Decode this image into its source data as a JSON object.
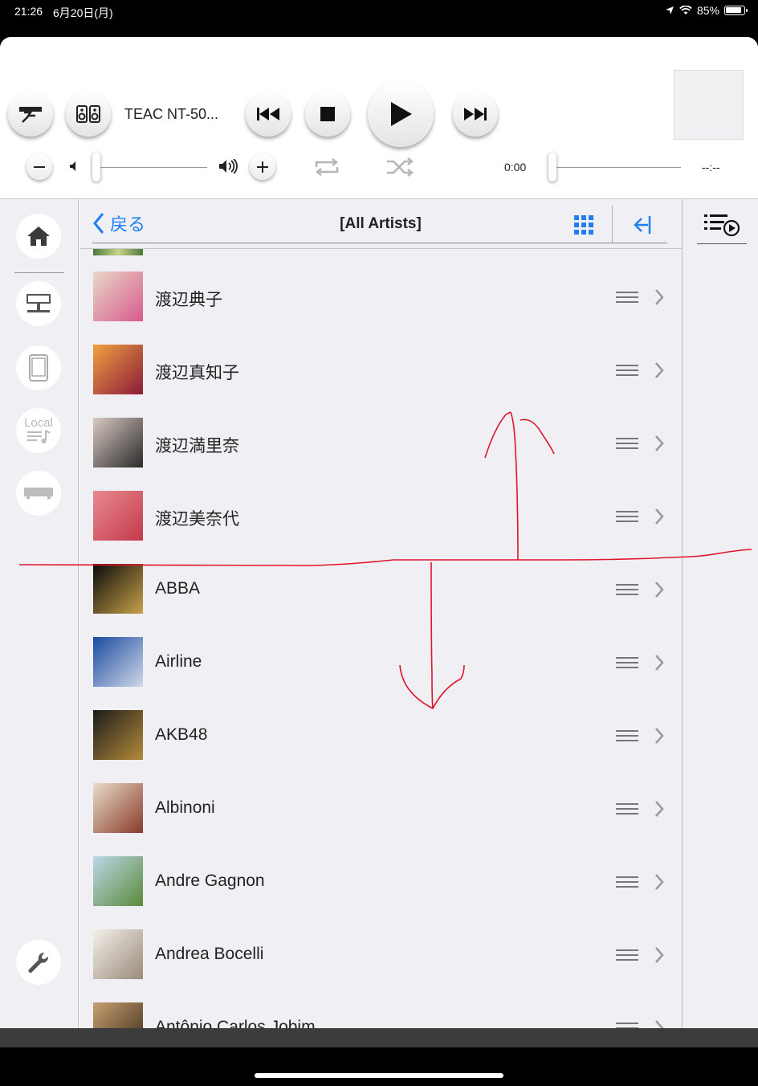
{
  "status_bar": {
    "time": "21:26",
    "date": "6月20日(月)",
    "battery": "85%"
  },
  "player": {
    "device_name": "TEAC NT-50...",
    "elapsed": "0:00",
    "remaining": "--:--"
  },
  "nav": {
    "back_label": "戻る",
    "title": "[All Artists]"
  },
  "sidebar": {
    "items": [
      {
        "icon": "home-icon"
      },
      {
        "icon": "network-device-icon"
      },
      {
        "icon": "tablet-icon"
      },
      {
        "icon": "local-music-icon",
        "label": "Local"
      },
      {
        "icon": "player-device-icon"
      },
      {
        "icon": "wrench-icon"
      }
    ]
  },
  "artists": [
    {
      "name": "渡辺典子",
      "art": [
        "#e8d7c8",
        "#d85a8c"
      ]
    },
    {
      "name": "渡辺真知子",
      "art": [
        "#f0a040",
        "#8a1a3a"
      ]
    },
    {
      "name": "渡辺満里奈",
      "art": [
        "#d9c9c3",
        "#2a2a2a"
      ]
    },
    {
      "name": "渡辺美奈代",
      "art": [
        "#e88a90",
        "#c23a4a"
      ]
    },
    {
      "name": "ABBA",
      "art": [
        "#0a0a0a",
        "#c9a24a"
      ]
    },
    {
      "name": "Airline",
      "art": [
        "#1b4aa0",
        "#d0d8e8"
      ]
    },
    {
      "name": "AKB48",
      "art": [
        "#1c1c1c",
        "#b48a3a"
      ]
    },
    {
      "name": "Albinoni",
      "art": [
        "#e8dcc8",
        "#8a3a2a"
      ]
    },
    {
      "name": "Andre Gagnon",
      "art": [
        "#bcd7e8",
        "#5a8a3a"
      ]
    },
    {
      "name": "Andrea Bocelli",
      "art": [
        "#f4f0ea",
        "#9a8a7a"
      ]
    },
    {
      "name": "Antônio Carlos Jobim",
      "art": [
        "#c8a070",
        "#3a2a1a"
      ]
    }
  ],
  "theme": {
    "accent": "#1f7ef5",
    "annotation": "#e0142a"
  }
}
